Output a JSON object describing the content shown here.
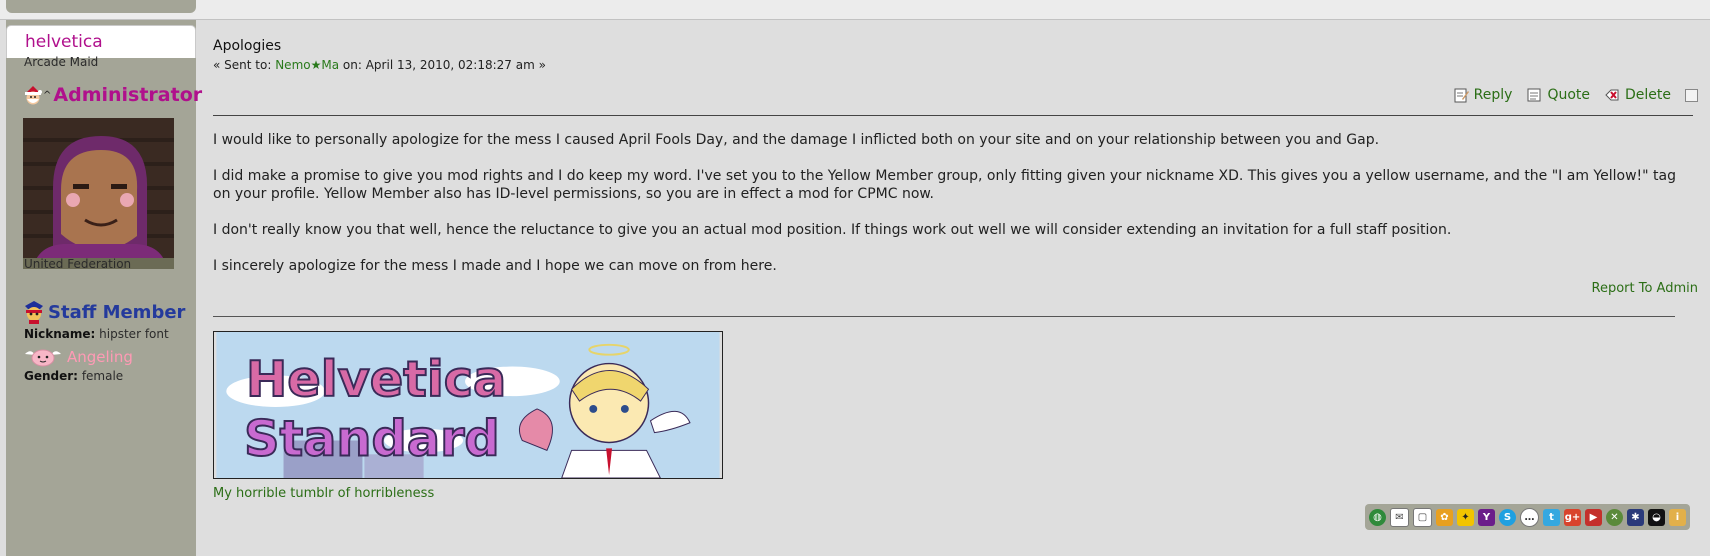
{
  "poster": {
    "name": "helvetica",
    "title": "Arcade Maid",
    "group": "Administrator",
    "location": "United Federation",
    "post_group": "Staff Member",
    "nickname_label": "Nickname:",
    "nickname": "hipster font",
    "badge": "Angeling",
    "gender_label": "Gender:",
    "gender": "female"
  },
  "message": {
    "subject": "Apologies",
    "sent_prefix": "« Sent to:",
    "recipient": "Nemo★Ma",
    "on_label": "on:",
    "date": "April 13, 2010, 02:18:27 am »",
    "paragraphs": [
      "I would like to personally apologize for the mess I caused April Fools Day, and the damage I inflicted both on your site and on your relationship between you and Gap.",
      "I did make a promise to give you mod rights and I do keep my word.  I've set you to the Yellow Member group, only fitting given your nickname XD.  This gives you a yellow username, and the \"I am Yellow!\" tag on your profile.  Yellow Member also has ID-level permissions, so you are in effect a mod for CPMC now.",
      "I don't really know you that well, hence the reluctance to give you an actual mod position.  If things work out well we will consider extending an invitation for a full staff position.",
      "I sincerely apologize for the mess I made and I hope we can move on from here."
    ],
    "report_link": "Report To Admin"
  },
  "actions": {
    "reply": "Reply",
    "quote": "Quote",
    "delete": "Delete"
  },
  "signature": {
    "banner_text_line1": "Helvetica",
    "banner_text_line2": "Standard",
    "link": "My horrible tumblr of horribleness"
  },
  "profile_icons": [
    "globe-icon",
    "email-icon",
    "pm-icon",
    "msn-icon",
    "aim-icon",
    "yahoo-icon",
    "skype-icon",
    "chat-icon",
    "twitter-icon",
    "googleplus-icon",
    "youtube-icon",
    "xbox-icon",
    "psn-icon",
    "steam-icon",
    "info-icon"
  ],
  "colors": {
    "sidebar": "#a4a597",
    "link_green": "#2b6e16",
    "admin_magenta": "#b0108c",
    "staff_blue": "#243a9c",
    "angel_pink": "#ff9ab5"
  }
}
